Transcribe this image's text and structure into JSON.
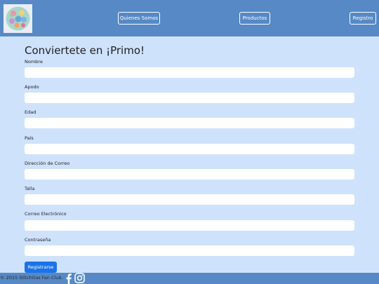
{
  "navbar": {
    "logo_icon": "stitch-logo-icon",
    "items": [
      {
        "label": "Quienes Somos"
      },
      {
        "label": "Productos"
      },
      {
        "label": "Registro"
      }
    ]
  },
  "form": {
    "title": "Conviertete en ¡Primo!",
    "fields": [
      {
        "label": "Nombre",
        "value": ""
      },
      {
        "label": "Apodo",
        "value": ""
      },
      {
        "label": "Edad",
        "value": ""
      },
      {
        "label": "País",
        "value": ""
      },
      {
        "label": "Dirección de Correo",
        "value": ""
      },
      {
        "label": "Talla",
        "value": ""
      },
      {
        "label": "Correo Electrónico",
        "value": ""
      },
      {
        "label": "Contraseña",
        "value": ""
      }
    ],
    "submit_label": "Registrarse"
  },
  "footer": {
    "copyright": "© 2015 Stitchitas Fan Club.",
    "social_icons": [
      "facebook-icon",
      "instagram-icon"
    ]
  },
  "colors": {
    "header": "#5689c5",
    "background": "#cfe2fb",
    "button": "#1a73e8"
  }
}
